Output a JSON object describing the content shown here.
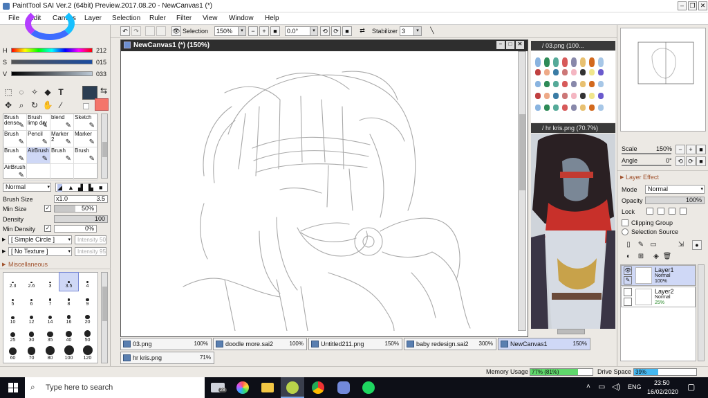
{
  "window": {
    "title": "PaintTool SAI Ver.2 (64bit) Preview.2017.08.20 - NewCanvas1 (*)"
  },
  "menu": [
    "File",
    "Edit",
    "Canvas",
    "Layer",
    "Selection",
    "Ruler",
    "Filter",
    "View",
    "Window",
    "Help"
  ],
  "toolbar": {
    "selection_label": "Selection",
    "zoom": "150%",
    "angle": "0.0°",
    "stabilizer_label": "Stabilizer",
    "stabilizer_value": "3"
  },
  "color": {
    "h_label": "H",
    "h_value": "212",
    "s_label": "S",
    "s_value": "015",
    "v_label": "V",
    "v_value": "033",
    "main_color": "#2b3d52",
    "sub_color": "#f4756a"
  },
  "brushes": {
    "rows": [
      [
        "Brush dense",
        "Brush limp dry",
        "blend",
        "Sketch"
      ],
      [
        "Brush",
        "Pencil",
        "Marker 2",
        "Marker"
      ],
      [
        "Brush",
        "AirBrush",
        "Brush",
        "Brush"
      ],
      [
        "AirBrush",
        "",
        "",
        ""
      ]
    ]
  },
  "tool_settings": {
    "blend_mode": "Normal",
    "brush_size_label": "Brush Size",
    "brush_size_mult": "x1.0",
    "brush_size_value": "3.5",
    "min_size_label": "Min Size",
    "min_size_value": "50%",
    "density_label": "Density",
    "density_value": "100",
    "min_density_label": "Min Density",
    "min_density_value": "0%",
    "shape": "[ Simple Circle ]",
    "shape_intensity": "Intensity 50",
    "texture": "[ No Texture ]",
    "texture_intensity": "Intensity 95",
    "misc_label": "Miscellaneous"
  },
  "brush_sizes": [
    "2.3",
    "2.6",
    "3",
    "3.5",
    "4",
    "5",
    "6",
    "7",
    "8",
    "9",
    "10",
    "12",
    "14",
    "16",
    "20",
    "25",
    "30",
    "35",
    "40",
    "50",
    "60",
    "70",
    "80",
    "100",
    "120"
  ],
  "canvas": {
    "title": "NewCanvas1 (*) (150%)"
  },
  "side_windows": [
    {
      "title": "/ 03.png (100..."
    },
    {
      "title": "/ hr kris.png (70.7%)"
    }
  ],
  "navigator": {
    "scale_label": "Scale",
    "scale_value": "150%",
    "angle_label": "Angle",
    "angle_value": "0°"
  },
  "layer_panel": {
    "effect_label": "Layer Effect",
    "mode_label": "Mode",
    "mode_value": "Normal",
    "opacity_label": "Opacity",
    "opacity_value": "100%",
    "lock_label": "Lock",
    "clipping_label": "Clipping Group",
    "selection_source_label": "Selection Source",
    "layers": [
      {
        "name": "Layer1",
        "mode": "Normal",
        "opacity": "100%"
      },
      {
        "name": "Layer2",
        "mode": "Normal",
        "opacity": "25%"
      }
    ]
  },
  "tabs": [
    {
      "name": "03.png",
      "zoom": "100%"
    },
    {
      "name": "doodle more.sai2",
      "zoom": "100%"
    },
    {
      "name": "Untitled211.png",
      "zoom": "150%"
    },
    {
      "name": "baby redesign.sai2",
      "zoom": "300%"
    },
    {
      "name": "NewCanvas1",
      "zoom": "150%"
    },
    {
      "name": "hr kris.png",
      "zoom": "71%"
    }
  ],
  "status": {
    "memory_label": "Memory Usage",
    "memory_value": "77% (81%)",
    "memory_fraction": 0.77,
    "drive_label": "Drive Space",
    "drive_value": "39%",
    "drive_fraction": 0.39
  },
  "taskbar": {
    "search_placeholder": "Type here to search",
    "mail_badge": "28",
    "lang": "ENG",
    "time": "23:50",
    "date": "16/02/2020"
  }
}
